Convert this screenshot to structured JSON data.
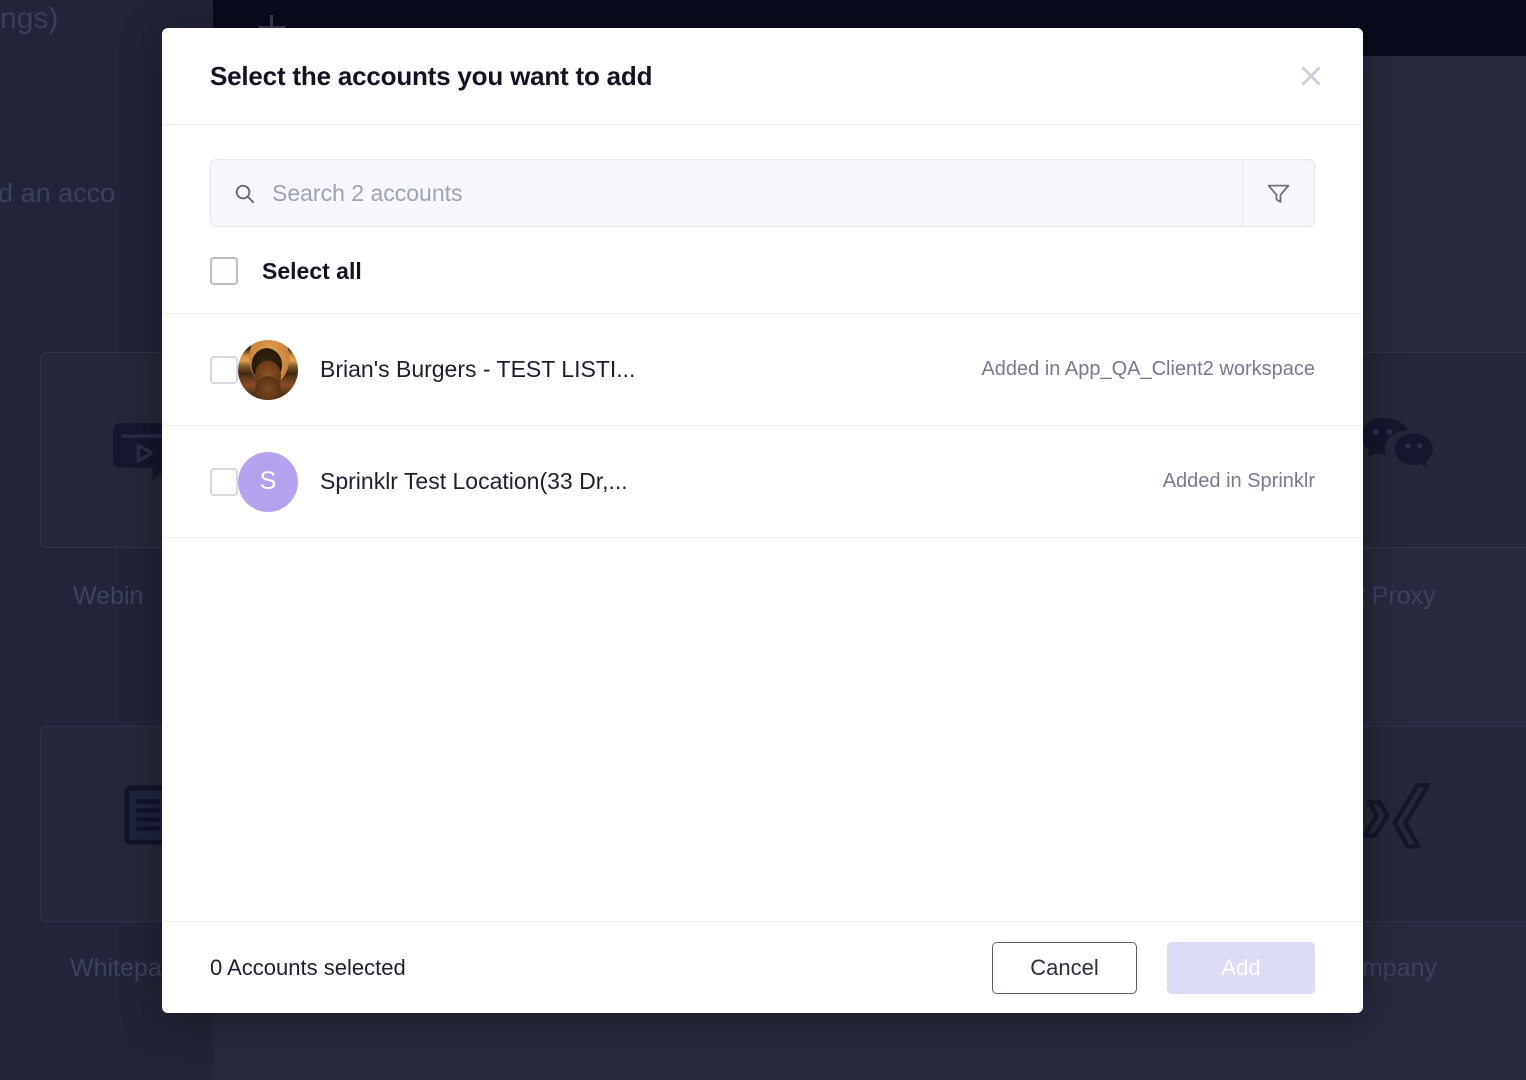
{
  "background": {
    "heading_fragment": "ettings)",
    "subtext_fragment": "to add an acco",
    "add_icon": "plus-icon",
    "cards": [
      {
        "id": "webinar",
        "icon": "webinar-player-icon",
        "label": "Webin"
      },
      {
        "id": "whitepaper",
        "icon": "document-lines-icon",
        "label": "Whitepa"
      },
      {
        "id": "wechat",
        "icon": "wechat-icon",
        "label": "hat Proxy"
      },
      {
        "id": "xing",
        "icon": "xing-icon",
        "label": "Company"
      }
    ]
  },
  "modal": {
    "title": "Select the accounts you want to add",
    "close_icon": "close-icon",
    "search": {
      "icon": "search-icon",
      "placeholder": "Search 2 accounts",
      "value": "",
      "filter_icon": "filter-funnel-icon"
    },
    "select_all": {
      "label": "Select all",
      "checked": false
    },
    "accounts": [
      {
        "name": "Brian's Burgers - TEST LISTI...",
        "avatar_type": "image",
        "avatar_label": "",
        "meta": "Added in App_QA_Client2 workspace",
        "checked": false
      },
      {
        "name": "Sprinklr Test Location(33 Dr,...",
        "avatar_type": "letter",
        "avatar_label": "S",
        "meta": "Added in Sprinklr",
        "checked": false
      }
    ],
    "footer": {
      "status": "0 Accounts selected",
      "cancel_label": "Cancel",
      "add_label": "Add",
      "add_disabled": true
    }
  },
  "colors": {
    "app_background": "#272A3D",
    "topbar": "#080B1C",
    "modal_background": "#FFFFFF",
    "title_text": "#111322",
    "muted_text": "#757A90",
    "placeholder": "#9EA2B5",
    "divider": "#EDEEF2",
    "search_background": "#F7F8FC",
    "avatar_letter_background": "#B5A2EE",
    "add_button_background": "#DCDCF3",
    "cancel_border": "#5A5E73"
  }
}
